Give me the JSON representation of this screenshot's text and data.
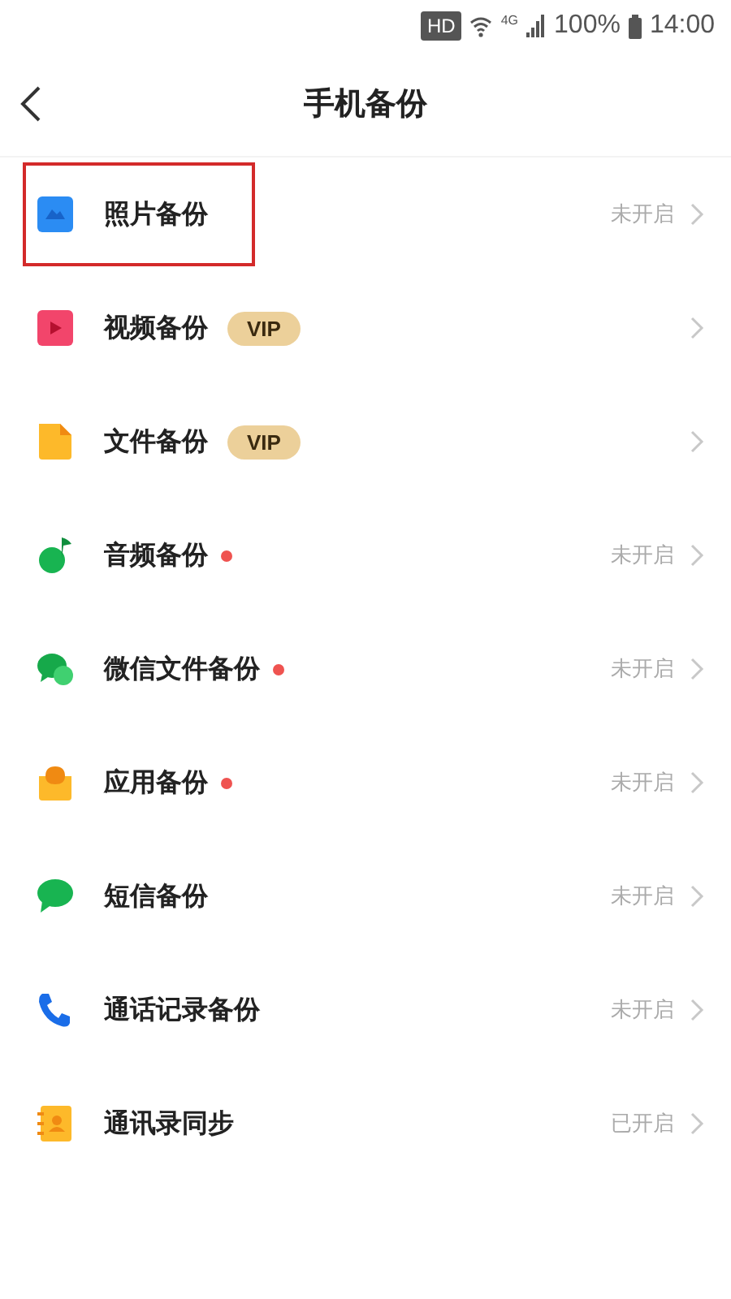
{
  "status_bar": {
    "hd": "HD",
    "network": "4G",
    "battery": "100%",
    "time": "14:00"
  },
  "header": {
    "title": "手机备份"
  },
  "items": [
    {
      "kind": "photo",
      "label": "照片备份",
      "vip": false,
      "new_dot": false,
      "status": "未开启",
      "highlighted": true
    },
    {
      "kind": "video",
      "label": "视频备份",
      "vip": true,
      "badge": "VIP",
      "new_dot": false,
      "highlighted": false
    },
    {
      "kind": "file",
      "label": "文件备份",
      "vip": true,
      "badge": "VIP",
      "new_dot": false,
      "highlighted": false
    },
    {
      "kind": "audio",
      "label": "音频备份",
      "vip": false,
      "new_dot": true,
      "status": "未开启",
      "highlighted": false
    },
    {
      "kind": "wechat",
      "label": "微信文件备份",
      "vip": false,
      "new_dot": true,
      "status": "未开启",
      "highlighted": false
    },
    {
      "kind": "app",
      "label": "应用备份",
      "vip": false,
      "new_dot": true,
      "status": "未开启",
      "highlighted": false
    },
    {
      "kind": "sms",
      "label": "短信备份",
      "vip": false,
      "new_dot": false,
      "status": "未开启",
      "highlighted": false
    },
    {
      "kind": "call",
      "label": "通话记录备份",
      "vip": false,
      "new_dot": false,
      "status": "未开启",
      "highlighted": false
    },
    {
      "kind": "contacts",
      "label": "通讯录同步",
      "vip": false,
      "new_dot": false,
      "status": "已开启",
      "highlighted": false
    }
  ]
}
